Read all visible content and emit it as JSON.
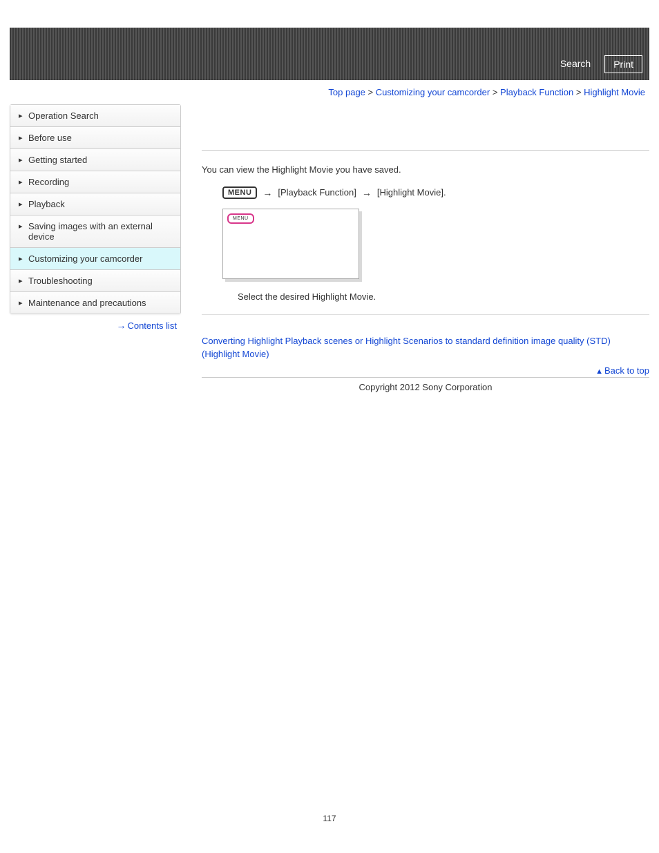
{
  "header": {
    "search": "Search",
    "print": "Print"
  },
  "breadcrumb": {
    "top": "Top page",
    "b1": "Customizing your camcorder",
    "b2": "Playback Function",
    "current": "Highlight Movie",
    "sep": ">"
  },
  "sidebar": {
    "items": [
      "Operation Search",
      "Before use",
      "Getting started",
      "Recording",
      "Playback",
      "Saving images with an external device",
      "Customizing your camcorder",
      "Troubleshooting",
      "Maintenance and precautions"
    ],
    "contents_list": "Contents list"
  },
  "content": {
    "intro": "You can view the Highlight Movie you have saved.",
    "menu_label": "MENU",
    "step1_a": "[Playback Function]",
    "step1_b": "[Highlight Movie].",
    "screen_menu": "MENU",
    "step2": "Select the desired Highlight Movie.",
    "related": "Converting Highlight Playback scenes or Highlight Scenarios to standard definition image quality (STD) (Highlight Movie)",
    "back_to_top": "Back to top"
  },
  "footer": {
    "copyright": "Copyright 2012 Sony Corporation",
    "page": "117"
  }
}
